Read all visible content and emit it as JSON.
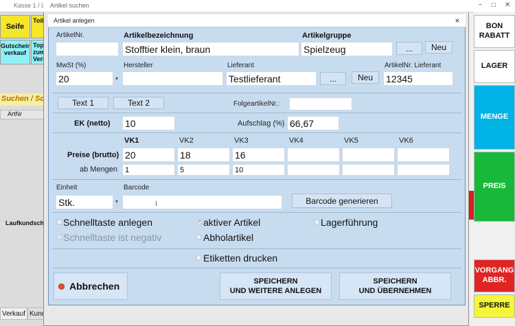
{
  "background": {
    "title": "Kasse 1 / Liste 1",
    "tiles": [
      "Seife",
      "Toilettenpapier",
      "Gutschein verkauf",
      "Topf zum Verkauf"
    ],
    "search_header": "Suchen / Sc",
    "col_header": "ArtNr",
    "customer_label": "Laufkundscha",
    "bottom_tabs": [
      "Verkauf",
      "Kund"
    ]
  },
  "outer_window": {
    "title": "Artikel suchen"
  },
  "right_panel": {
    "window_controls": [
      "−",
      "□",
      "✕"
    ],
    "buttons": [
      {
        "label": "BON RABATT",
        "color": "#ffffff"
      },
      {
        "label": "LAGER",
        "color": "#ffffff"
      },
      {
        "label": "MENGE",
        "color": "#00b2e6"
      },
      {
        "label": "PREIS",
        "color": "#18b83a"
      },
      {
        "label": "VORGANG ABBR.",
        "color": "#e02424"
      },
      {
        "label": "SPERRE",
        "color": "#f5f53a"
      }
    ]
  },
  "dialog": {
    "title": "Artikel anlegen",
    "close_glyph": "×",
    "artikelnr": {
      "label": "ArtikelNr.",
      "value": ""
    },
    "bezeichnung": {
      "label": "Artikelbezeichnung",
      "value": "Stofftier klein, braun"
    },
    "gruppe": {
      "label": "Artikelgruppe",
      "value": "Spielzeug",
      "dots": "...",
      "new": "Neu"
    },
    "mwst": {
      "label": "MwSt (%)",
      "value": "20"
    },
    "hersteller": {
      "label": "Hersteller",
      "value": ""
    },
    "lieferant": {
      "label": "Lieferant",
      "value": "Testlieferant",
      "dots": "...",
      "new": "Neu"
    },
    "lieferant_artnr": {
      "label": "ArtikelNr. Lieferant",
      "value": "12345"
    },
    "text1": "Text 1",
    "text2": "Text 2",
    "folgeartikel": {
      "label": "FolgeartikelNr.:",
      "value": ""
    },
    "ek": {
      "label": "EK (netto)",
      "value": "10"
    },
    "aufschlag": {
      "label": "Aufschlag (%)",
      "value": "66,67"
    },
    "preise": {
      "row_label": "Preise (brutto)",
      "mengen_label": "ab Mengen",
      "columns": [
        "VK1",
        "VK2",
        "VK3",
        "VK4",
        "VK5",
        "VK6"
      ],
      "prices": [
        "20",
        "18",
        "16",
        "",
        "",
        ""
      ],
      "mengen": [
        "1",
        "5",
        "10",
        "",
        "",
        ""
      ]
    },
    "einheit": {
      "label": "Einheit",
      "value": "Stk."
    },
    "barcode": {
      "label": "Barcode",
      "value": "",
      "generate": "Barcode generieren"
    },
    "checks": {
      "schnelltaste": "Schnelltaste anlegen",
      "schnelltaste_negativ": "Schnelltaste ist negativ",
      "aktiver_artikel": "aktiver Artikel",
      "lagerfuehrung": "Lagerführung",
      "abholartikel": "Abholartikel",
      "etiketten": "Etiketten drucken"
    },
    "abbrechen": "Abbrechen",
    "speichern_weitere": [
      "SPEICHERN",
      "UND WEITERE ANLEGEN"
    ],
    "speichern_uebernehmen": [
      "SPEICHERN",
      "UND ÜBERNEHMEN"
    ]
  }
}
